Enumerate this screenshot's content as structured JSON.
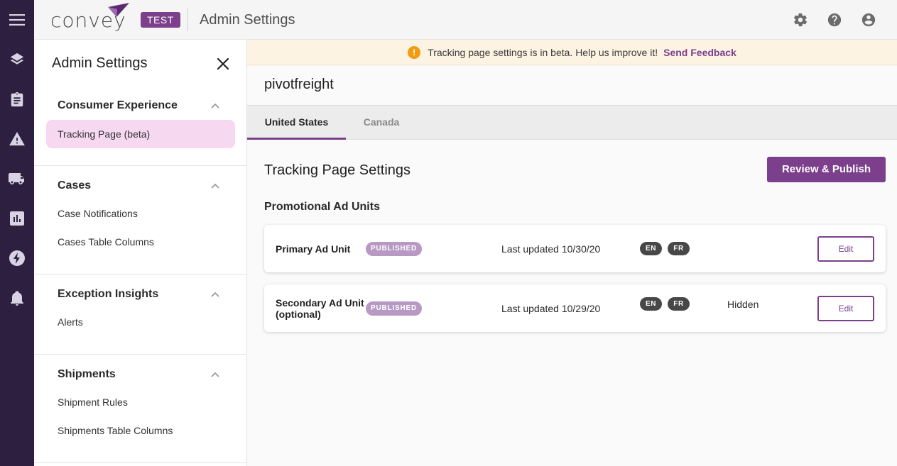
{
  "header": {
    "logo_text": "convey",
    "env_badge": "TEST",
    "page_title": "Admin Settings"
  },
  "panel": {
    "title": "Admin Settings",
    "sections": [
      {
        "title": "Consumer Experience",
        "items": [
          "Tracking Page (beta)"
        ]
      },
      {
        "title": "Cases",
        "items": [
          "Case Notifications",
          "Cases Table Columns"
        ]
      },
      {
        "title": "Exception Insights",
        "items": [
          "Alerts"
        ]
      },
      {
        "title": "Shipments",
        "items": [
          "Shipment Rules",
          "Shipments Table Columns"
        ]
      }
    ]
  },
  "banner": {
    "message": "Tracking page settings is in beta. Help us improve it!",
    "link": "Send Feedback"
  },
  "main": {
    "account": "pivotfreight",
    "tabs": [
      "United States",
      "Canada"
    ],
    "title": "Tracking Page Settings",
    "publish_label": "Review & Publish",
    "subtitle": "Promotional Ad Units",
    "ad_units": [
      {
        "name": "Primary Ad Unit",
        "status": "PUBLISHED",
        "updated": "Last updated 10/30/20",
        "langs": [
          "EN",
          "FR"
        ],
        "visibility": "",
        "edit": "Edit"
      },
      {
        "name": "Secondary Ad Unit (optional)",
        "status": "PUBLISHED",
        "updated": "Last updated 10/29/20",
        "langs": [
          "EN",
          "FR"
        ],
        "visibility": "Hidden",
        "edit": "Edit"
      }
    ]
  },
  "colors": {
    "brand": "#7b3f8c",
    "rail": "#2d1f3f",
    "active_nav": "#f6d8f1",
    "banner": "#fdf3e3",
    "badge": "#b799c4"
  },
  "icons": {
    "rail": [
      "menu-icon",
      "layers-icon",
      "clipboard-icon",
      "warning-icon",
      "truck-icon",
      "bar-chart-icon",
      "bolt-icon",
      "bell-icon"
    ],
    "topbar": [
      "gear-icon",
      "help-icon",
      "account-icon"
    ]
  }
}
